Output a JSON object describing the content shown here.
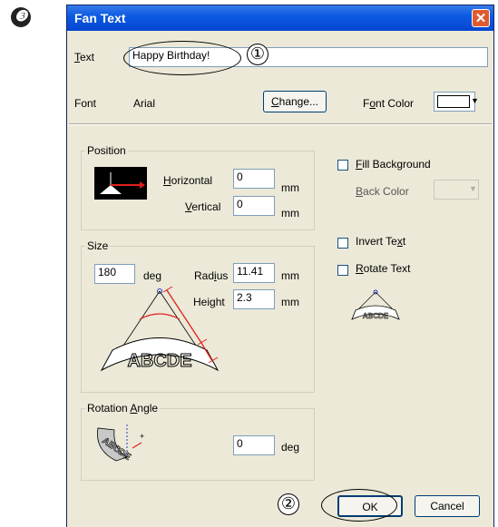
{
  "step_marker": "❸",
  "dialog": {
    "title": "Fan Text",
    "close_glyph": "✕",
    "text_label": "Text",
    "text_value": "Happy Birthday!",
    "font_label": "Font",
    "font_value": "Arial",
    "change_button": "Change...",
    "font_color_label": "Font Color",
    "font_color_swatch": "#ffffff",
    "position": {
      "title": "Position",
      "horizontal_label": "Horizontal",
      "horizontal_value": "0",
      "vertical_label": "Vertical",
      "vertical_value": "0",
      "unit": "mm"
    },
    "size": {
      "title": "Size",
      "angle_value": "180",
      "angle_unit": "deg",
      "radius_label": "Radius",
      "radius_value": "11.41",
      "height_label": "Height",
      "height_value": "2.3",
      "unit": "mm",
      "preview_text": "ABCDE"
    },
    "rotation": {
      "title": "Rotation Angle",
      "value": "0",
      "unit": "deg",
      "preview_text": "ABCDE"
    },
    "fill_background_label": "Fill Background",
    "back_color_label": "Back Color",
    "invert_text_label": "Invert Text",
    "rotate_text_label": "Rotate Text",
    "rotate_preview_text": "ABCDE",
    "ok_button": "OK",
    "cancel_button": "Cancel"
  },
  "callouts": {
    "first": "①",
    "second": "②"
  },
  "colors": {
    "title_bar": "#0c5be3",
    "arrow_red": "#e0201c"
  }
}
